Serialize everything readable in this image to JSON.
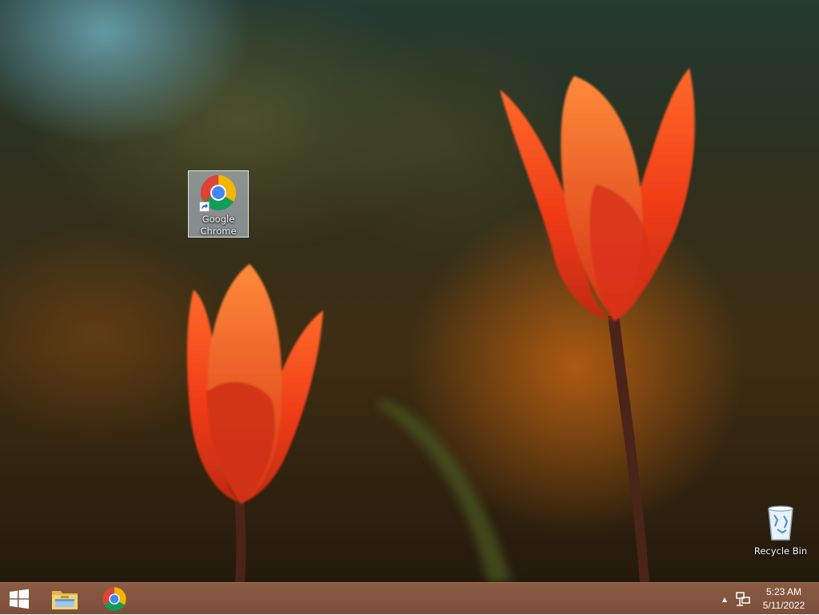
{
  "desktop": {
    "wallpaper": "red tulips on blurred background",
    "icons": [
      {
        "label": "Google\nChrome",
        "icon": "chrome-icon",
        "shortcut": true,
        "selected": true
      },
      {
        "label": "Recycle Bin",
        "icon": "recycle-bin-icon"
      }
    ]
  },
  "taskbar": {
    "start_icon": "windows-logo-icon",
    "pinned": [
      {
        "name": "File Explorer",
        "icon": "folder-icon"
      },
      {
        "name": "Google Chrome",
        "icon": "chrome-icon"
      }
    ],
    "tray": {
      "chevron_icon": "show-hidden-icons-chevron",
      "network_icon": "network-icon"
    },
    "clock": {
      "time": "5:23 AM",
      "date": "5/11/2022"
    }
  },
  "colors": {
    "taskbar": "#7c4e39",
    "tulip": "#e8391a",
    "chrome_red": "#db4437",
    "chrome_yellow": "#f4b400",
    "chrome_green": "#0f9d58",
    "chrome_blue": "#4285f4"
  }
}
